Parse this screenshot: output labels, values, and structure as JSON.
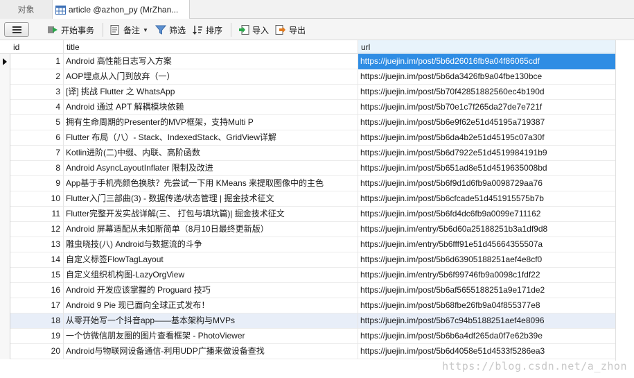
{
  "tabs": [
    {
      "label": "对象"
    },
    {
      "label": "article @azhon_py (MrZhan..."
    }
  ],
  "toolbar": {
    "begin_transaction": "开始事务",
    "memo": "备注",
    "filter": "筛选",
    "sort": "排序",
    "import": "导入",
    "export": "导出"
  },
  "columns": {
    "id": "id",
    "title": "title",
    "url": "url"
  },
  "rows": [
    {
      "id": "1",
      "title": "Android 高性能日志写入方案",
      "url": "https://juejin.im/post/5b6d26016fb9a04f86065cdf"
    },
    {
      "id": "2",
      "title": "AOP埋点从入门到放弃（一）",
      "url": "https://juejin.im/post/5b6da3426fb9a04fbe130bce"
    },
    {
      "id": "3",
      "title": "[译] 挑战 Flutter 之 WhatsApp",
      "url": "https://juejin.im/post/5b70f42851882560ec4b190d"
    },
    {
      "id": "4",
      "title": "Android 通过 APT 解耦模块依赖",
      "url": "https://juejin.im/post/5b70e1c7f265da27de7e721f"
    },
    {
      "id": "5",
      "title": "拥有生命周期的Presenter的MVP框架，支持Multi P",
      "url": "https://juejin.im/post/5b6e9f62e51d45195a719387"
    },
    {
      "id": "6",
      "title": "Flutter 布局（八）- Stack、IndexedStack、GridView详解",
      "url": "https://juejin.im/post/5b6da4b2e51d45195c07a30f"
    },
    {
      "id": "7",
      "title": "Kotlin进阶(二)中缀、内联、高阶函数",
      "url": "https://juejin.im/post/5b6d7922e51d4519984191b9"
    },
    {
      "id": "8",
      "title": "Android AsyncLayoutInflater 限制及改进",
      "url": "https://juejin.im/post/5b651ad8e51d4519635008bd"
    },
    {
      "id": "9",
      "title": "App基于手机壳颜色换肤？先尝试一下用 KMeans 来提取图像中的主色",
      "url": "https://juejin.im/post/5b6f9d1d6fb9a0098729aa76"
    },
    {
      "id": "10",
      "title": "Flutter入门三部曲(3) - 数据传递/状态管理 | 掘金技术征文",
      "url": "https://juejin.im/post/5b6cfcade51d451915575b7b"
    },
    {
      "id": "11",
      "title": "Flutter完整开发实战详解(三、 打包与填坑篇)| 掘金技术征文",
      "url": "https://juejin.im/post/5b6fd4dc6fb9a0099e711162"
    },
    {
      "id": "12",
      "title": "Android 屏幕适配从未如斯简单（8月10日最终更新版）",
      "url": "https://juejin.im/entry/5b6d60a25188251b3a1df9d8"
    },
    {
      "id": "13",
      "title": "雕虫晓技(八) Android与数据流的斗争",
      "url": "https://juejin.im/entry/5b6fff91e51d45664355507a"
    },
    {
      "id": "14",
      "title": "自定义标签FlowTagLayout",
      "url": "https://juejin.im/post/5b6d63905188251aef4e8cf0"
    },
    {
      "id": "15",
      "title": "自定义组织机构图-LazyOrgView",
      "url": "https://juejin.im/entry/5b6f99746fb9a0098c1fdf22"
    },
    {
      "id": "16",
      "title": "Android 开发应该掌握的 Proguard 技巧",
      "url": "https://juejin.im/post/5b6af5655188251a9e171de2"
    },
    {
      "id": "17",
      "title": "Android 9 Pie 现已面向全球正式发布！",
      "url": "https://juejin.im/post/5b68fbe26fb9a04f855377e8"
    },
    {
      "id": "18",
      "title": "从零开始写一个抖音app——基本架构与MVPs",
      "url": "https://juejin.im/post/5b67c94b5188251aef4e8096"
    },
    {
      "id": "19",
      "title": "一个仿微信朋友圈的图片查看框架 - PhotoViewer",
      "url": "https://juejin.im/post/5b6b6a4df265da0f7e62b39e"
    },
    {
      "id": "20",
      "title": "Android与物联网设备通信-利用UDP广播来做设备查找",
      "url": "https://juejin.im/post/5b6d4058e51d4533f5286ea3"
    }
  ],
  "watermark": "https://blog.csdn.net/a_zhon",
  "colors": {
    "selection": "#2f8de4",
    "header_highlight": "#e8f3fb"
  }
}
